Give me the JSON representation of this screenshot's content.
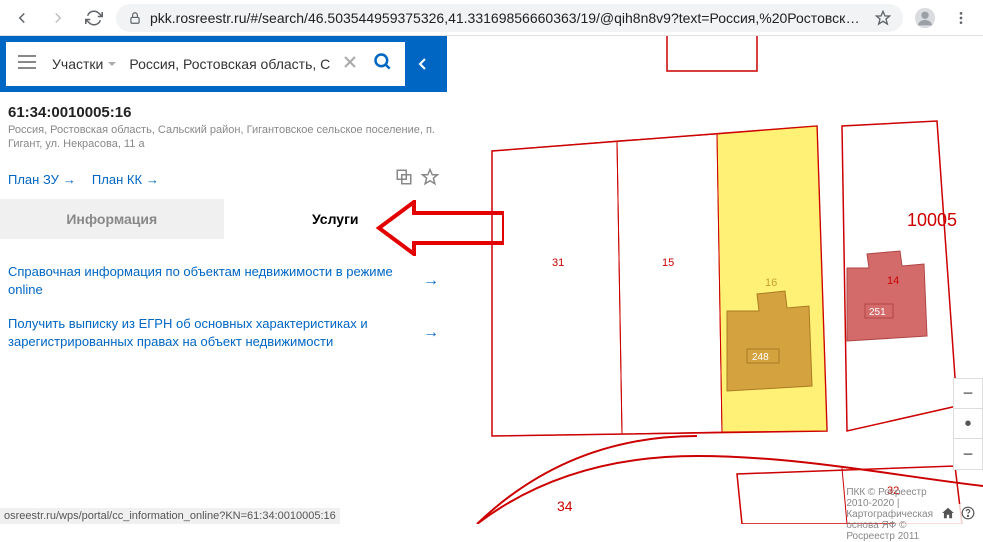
{
  "browser": {
    "url": "pkk.rosreestr.ru/#/search/46.5035449593753​26,41.33169856660363/19/@qih8n8v9?text=Россия,%20Ростовская%20обла..."
  },
  "search": {
    "category": "Участки",
    "value": "Россия, Ростовская область, С"
  },
  "parcel": {
    "id": "61:34:0010005:16",
    "address": "Россия, Ростовская область, Сальский район, Гигантовское сельское поселение, п. Гигант, ул. Некрасова, 11 а"
  },
  "plans": {
    "zu": "План ЗУ",
    "kk": "План КК"
  },
  "tabs": {
    "info": "Информация",
    "services": "Услуги"
  },
  "services": [
    {
      "text": "Справочная информация по объектам недвижимости в режиме online"
    },
    {
      "text": "Получить выписку из ЕГРН об основных характеристиках и зарегистрированных правах на объект недвижимости"
    }
  ],
  "map": {
    "block": "10005",
    "parcels": {
      "p31": "31",
      "p15": "15",
      "p16": "16",
      "p14": "14",
      "b248": "248",
      "b251": "251",
      "p34": "34",
      "p32": "32"
    }
  },
  "footer": {
    "text": "ПКК © Росреестр 2010-2020 | Картографическая основа ЯФ © Росреестр 2011"
  },
  "status": "osreestr.ru/wps/portal/cc_information_online?KN=61:34:0010005:16"
}
